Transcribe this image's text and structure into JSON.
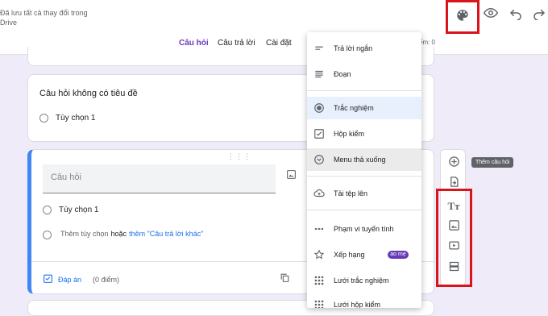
{
  "header": {
    "save_status_line1": "Đã lưu tất cả thay đổi trong",
    "save_status_line2": "Drive",
    "right_text": "ểm: 0"
  },
  "tabs": [
    {
      "label": "Câu hỏi",
      "active": true
    },
    {
      "label": "Câu trả lời",
      "active": false
    },
    {
      "label": "Cài đặt",
      "active": false
    }
  ],
  "question1": {
    "title": "Câu hỏi không có tiêu đề",
    "option": "Tùy chọn 1"
  },
  "active_question": {
    "placeholder": "Câu hỏi",
    "option": "Tùy chọn 1",
    "add_option": "Thêm tùy chọn",
    "or_text": "hoặc",
    "add_other": "thêm \"Câu trả lời khác\"",
    "answer_key": "Đáp án",
    "points": "(0 điểm)"
  },
  "tooltip": "Thêm câu hỏi",
  "menu": {
    "items": [
      {
        "label": "Trả lời ngắn",
        "icon": "short-answer-icon"
      },
      {
        "label": "Đoạn",
        "icon": "paragraph-icon"
      },
      {
        "label": "Trắc nghiệm",
        "icon": "radio-icon",
        "state": "selected"
      },
      {
        "label": "Hộp kiểm",
        "icon": "checkbox-icon"
      },
      {
        "label": "Menu thả xuống",
        "icon": "dropdown-icon",
        "state": "hover"
      },
      {
        "label": "Tải tệp lên",
        "icon": "upload-icon"
      },
      {
        "label": "Phạm vi tuyến tính",
        "icon": "linear-scale-icon"
      },
      {
        "label": "Xếp hạng",
        "icon": "star-icon",
        "badge": "ao mẹ"
      },
      {
        "label": "Lưới trắc nghiệm",
        "icon": "grid-icon"
      },
      {
        "label": "Lưới hộp kiểm",
        "icon": "grid-icon"
      }
    ]
  },
  "colors": {
    "accent": "#673ab7",
    "highlight_border": "#d9141a",
    "link": "#1a73e8",
    "background": "#f0ebf8"
  }
}
